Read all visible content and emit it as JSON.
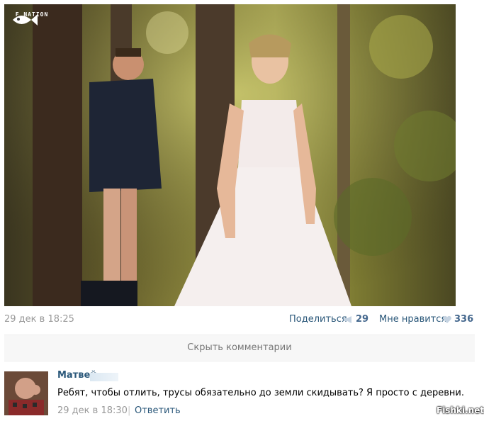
{
  "photo": {
    "watermark_text": "F_NATION"
  },
  "post": {
    "date": "29 дек в 18:25",
    "share_label": "Поделиться",
    "share_count": "29",
    "like_label": "Мне нравится",
    "like_count": "336"
  },
  "comments_toggle": "Скрыть комментарии",
  "comment": {
    "author": "Матвей",
    "text": "Ребят, чтобы отлить, трусы обязательно до земли скидывать? Я просто с деревни.",
    "time": "29 дек в 18:30",
    "separator": "|",
    "reply_label": "Ответить"
  },
  "site_watermark": "Fishki.net",
  "colors": {
    "link": "#2b587a",
    "count": "#45688e",
    "muted": "#999999",
    "toggle_bg": "#f7f7f7"
  }
}
